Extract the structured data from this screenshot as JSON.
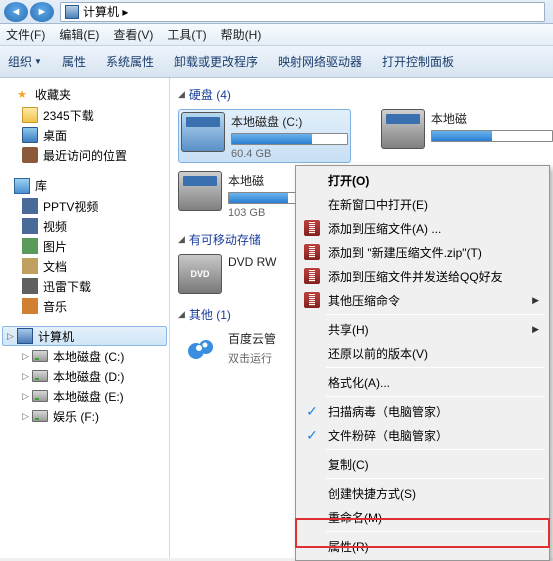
{
  "addressbar": {
    "path": "计算机  ▸"
  },
  "menubar": {
    "file": "文件(F)",
    "edit": "编辑(E)",
    "view": "查看(V)",
    "tools": "工具(T)",
    "help": "帮助(H)"
  },
  "toolbar": {
    "organize": "组织",
    "properties": "属性",
    "sysprops": "系统属性",
    "uninstall": "卸载或更改程序",
    "mapdrive": "映射网络驱动器",
    "ctrlpanel": "打开控制面板"
  },
  "sidebar": {
    "favorites": {
      "label": "收藏夹",
      "items": [
        {
          "label": "2345下载"
        },
        {
          "label": "桌面"
        },
        {
          "label": "最近访问的位置"
        }
      ]
    },
    "libraries": {
      "label": "库",
      "items": [
        {
          "label": "PPTV视频"
        },
        {
          "label": "视频"
        },
        {
          "label": "图片"
        },
        {
          "label": "文档"
        },
        {
          "label": "迅雷下载"
        },
        {
          "label": "音乐"
        }
      ]
    },
    "computer": {
      "label": "计算机",
      "items": [
        {
          "label": "本地磁盘 (C:)"
        },
        {
          "label": "本地磁盘 (D:)"
        },
        {
          "label": "本地磁盘 (E:)"
        },
        {
          "label": "娱乐 (F:)"
        }
      ]
    }
  },
  "content": {
    "hdd": {
      "label": "硬盘 (4)",
      "drives": [
        {
          "name": "本地磁盘 (C:)",
          "size": "60.4 GB",
          "fill": 70
        },
        {
          "name": "本地磁",
          "size": "",
          "fill": 50
        },
        {
          "name": "本地磁",
          "size": "103 GB",
          "fill": 40
        }
      ]
    },
    "removable": {
      "label": "有可移动存储",
      "items": [
        {
          "name": "DVD RW"
        }
      ]
    },
    "other": {
      "label": "其他 (1)",
      "items": [
        {
          "name": "百度云管",
          "sub": "双击运行"
        }
      ]
    }
  },
  "context_menu": {
    "open": "打开(O)",
    "newwin": "在新窗口中打开(E)",
    "addzip": "添加到压缩文件(A) ...",
    "newzip": "添加到 \"新建压缩文件.zip\"(T)",
    "sendqq": "添加到压缩文件并发送给QQ好友",
    "otherzip": "其他压缩命令",
    "share": "共享(H)",
    "prevver": "还原以前的版本(V)",
    "format": "格式化(A)...",
    "scan": "扫描病毒（电脑管家）",
    "shred": "文件粉碎（电脑管家）",
    "copy": "复制(C)",
    "shortcut": "创建快捷方式(S)",
    "rename": "重命名(M)",
    "props": "属性(R)"
  }
}
